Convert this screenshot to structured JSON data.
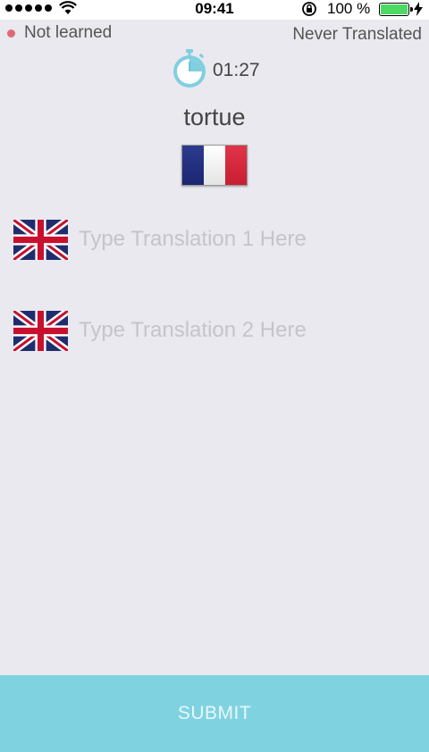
{
  "status_bar": {
    "time": "09:41",
    "battery_percent": "100 %",
    "battery_level": 1.0,
    "signal_bars": 5
  },
  "word_status": {
    "learned": "Not learned",
    "translated": "Never Translated",
    "dot_color": "#e06a74"
  },
  "timer": {
    "icon": "stopwatch-icon",
    "value": "01:27"
  },
  "word": {
    "text": "tortue",
    "language_flag": "france-flag-icon"
  },
  "translations": [
    {
      "flag": "uk-flag-icon",
      "placeholder": "Type Translation 1 Here",
      "value": ""
    },
    {
      "flag": "uk-flag-icon",
      "placeholder": "Type Translation 2 Here",
      "value": ""
    }
  ],
  "submit": {
    "label": "SUBMIT",
    "color": "#7fd3e1"
  }
}
